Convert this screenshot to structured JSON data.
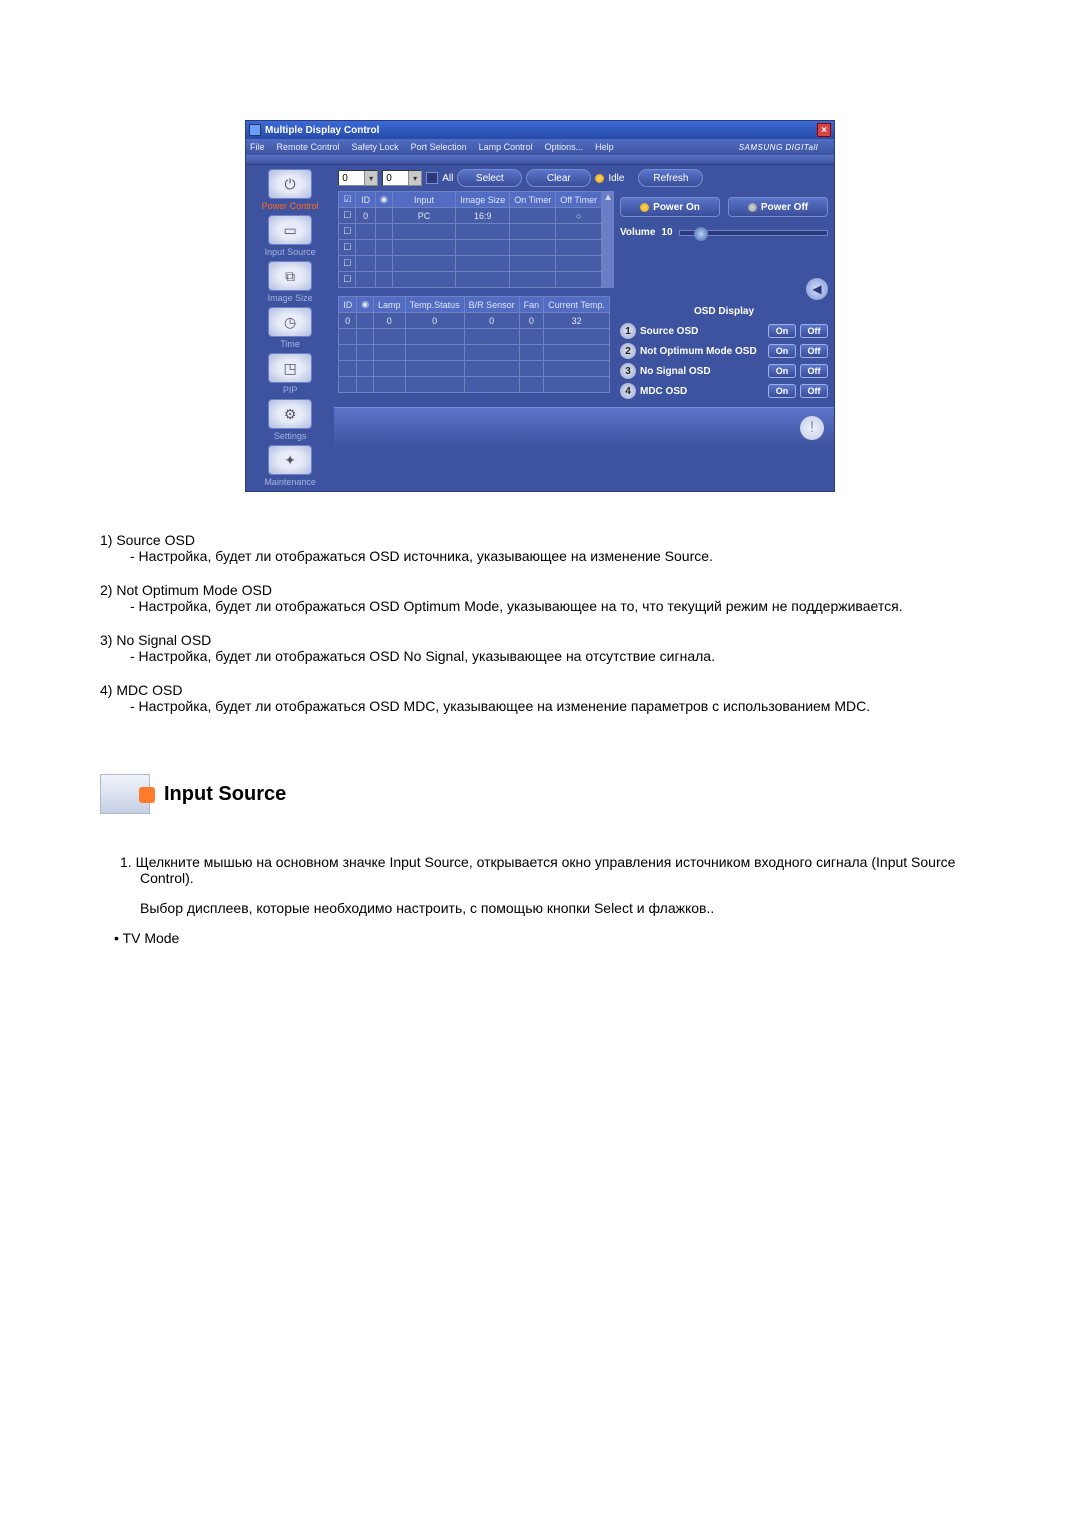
{
  "window": {
    "title": "Multiple Display Control",
    "brand": "SAMSUNG DIGITall"
  },
  "menu": {
    "file": "File",
    "remote": "Remote Control",
    "safety": "Safety Lock",
    "port": "Port Selection",
    "lamp": "Lamp Control",
    "options": "Options...",
    "help": "Help"
  },
  "toolbar": {
    "spin0": "0",
    "spin1": "0",
    "all_label": "All",
    "select": "Select",
    "clear": "Clear",
    "idle": "Idle",
    "refresh": "Refresh"
  },
  "sidebar": {
    "items": [
      {
        "label": "Power Control"
      },
      {
        "label": "Input Source"
      },
      {
        "label": "Image Size"
      },
      {
        "label": "Time"
      },
      {
        "label": "PIP"
      },
      {
        "label": "Settings"
      },
      {
        "label": "Maintenance"
      }
    ]
  },
  "top_grid": {
    "headers": {
      "chk": "",
      "id": "ID",
      "stat": "",
      "input": "Input",
      "size": "Image Size",
      "on": "On Timer",
      "off": "Off Timer"
    },
    "row": {
      "id": "0",
      "input": "PC",
      "size": "16:9"
    }
  },
  "bottom_grid": {
    "headers": {
      "id": "ID",
      "stat": "",
      "lamp": "Lamp",
      "temp": "Temp.Status",
      "br": "B/R Sensor",
      "fan": "Fan",
      "ctemp": "Current Temp."
    },
    "row": {
      "id": "0",
      "lamp": "0",
      "temp": "0",
      "br": "0",
      "fan": "0",
      "ctemp": "32"
    }
  },
  "power": {
    "on": "Power On",
    "off": "Power Off"
  },
  "volume": {
    "label": "Volume",
    "value": "10"
  },
  "osd": {
    "heading": "OSD Display",
    "rows": [
      {
        "n": "1",
        "label": "Source OSD"
      },
      {
        "n": "2",
        "label": "Not Optimum Mode OSD"
      },
      {
        "n": "3",
        "label": "No Signal OSD"
      },
      {
        "n": "4",
        "label": "MDC OSD"
      }
    ],
    "on": "On",
    "off": "Off"
  },
  "doc": {
    "items": [
      {
        "term": "1)  Source OSD",
        "desc": "- Настройка, будет ли отображаться OSD источника, указывающее на изменение Source."
      },
      {
        "term": "2)  Not Optimum Mode OSD",
        "desc": "- Настройка, будет ли отображаться OSD Optimum Mode, указывающее на то, что текущий режим не поддерживается."
      },
      {
        "term": "3)  No Signal OSD",
        "desc": "- Настройка, будет ли отображаться OSD No Signal, указывающее на отсутствие сигнала."
      },
      {
        "term": "4)  MDC OSD",
        "desc": "- Настройка, будет ли отображаться OSD MDC, указывающее на изменение параметров с использованием MDC."
      }
    ],
    "section_heading": "Input Source",
    "step1a": "1.  Щелкните мышью на основном значке Input Source, открывается окно управления источником входного сигнала (Input Source Control).",
    "step1b": "Выбор дисплеев, которые необходимо настроить, с помощью кнопки Select и флажков..",
    "bullet": "• TV Mode"
  }
}
